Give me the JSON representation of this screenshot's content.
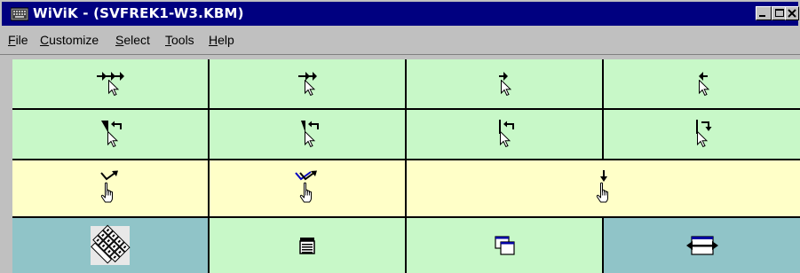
{
  "window": {
    "title": "WiViK -  (SVFREK1-W3.KBM)",
    "controls": [
      "minimize",
      "maximize",
      "close"
    ]
  },
  "menu": {
    "file": {
      "accel": "F",
      "rest": "ile"
    },
    "customize": {
      "accel": "C",
      "rest": "ustomize"
    },
    "select": {
      "accel": "S",
      "rest": "elect"
    },
    "tools": {
      "accel": "T",
      "rest": "ools"
    },
    "help": {
      "accel": "H",
      "rest": "elp"
    }
  },
  "keyboard": {
    "rows": [
      {
        "background": "#c8f8c8",
        "keys": [
          "move-right-fast-icon",
          "move-right-medium-icon",
          "move-right-slow-icon",
          "move-left-slow-icon"
        ]
      },
      {
        "background": "#c8f8c8",
        "keys": [
          "scroll-back-big-icon",
          "scroll-back-medium-icon",
          "line-back-icon",
          "line-down-icon"
        ]
      },
      {
        "background": "#ffffc8",
        "keys": [
          "click-select-icon",
          "double-click-select-icon",
          "click-down-icon"
        ]
      },
      {
        "background": "#90c4c8",
        "keys": [
          "keyboard-switch-icon",
          "text-document-icon",
          "window-switch-icon",
          "resize-horizontal-icon"
        ]
      }
    ]
  }
}
